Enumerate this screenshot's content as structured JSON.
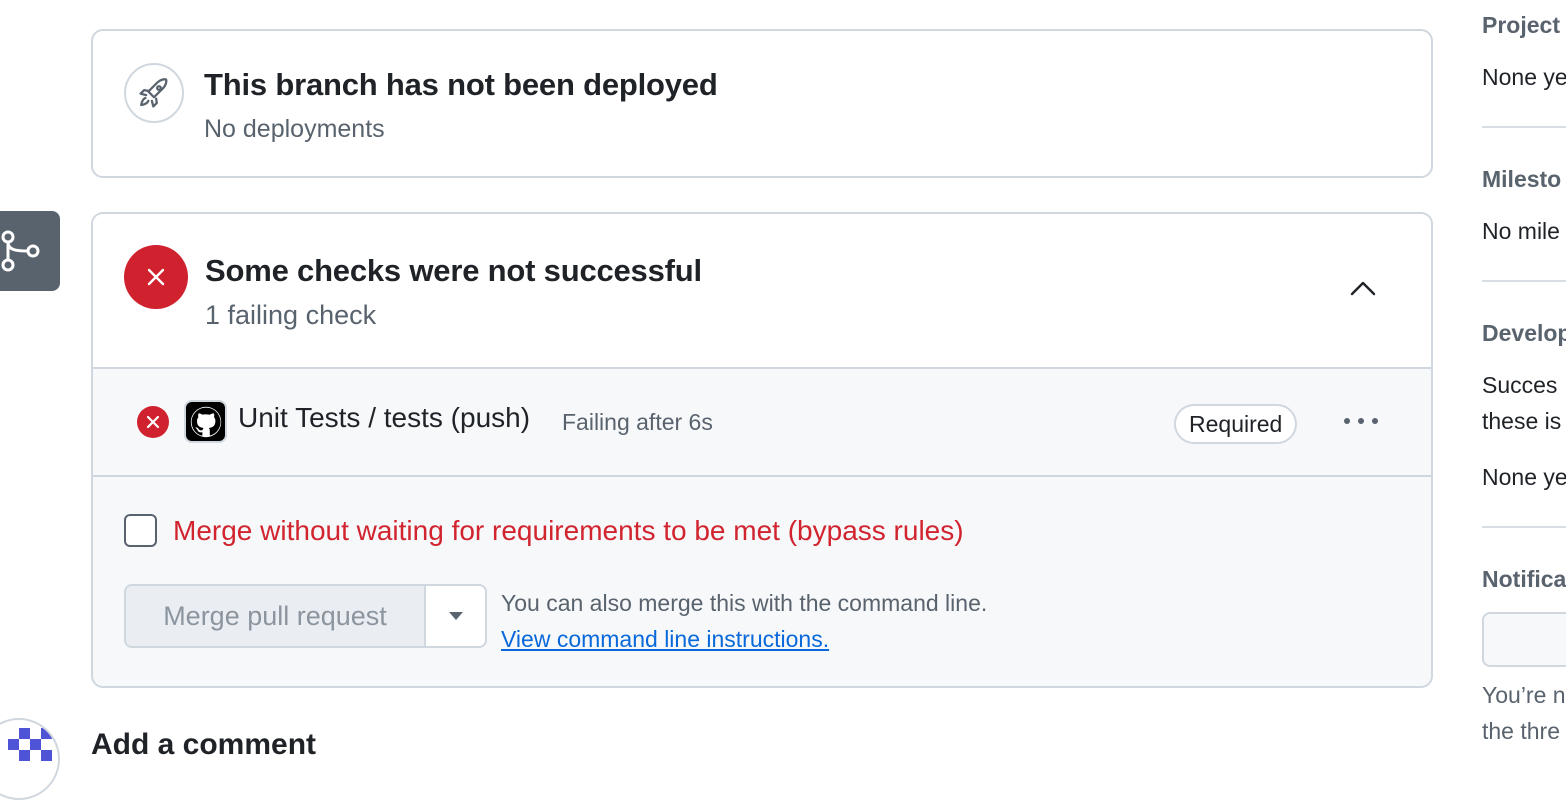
{
  "deployment": {
    "title": "This branch has not been deployed",
    "subtitle": "No deployments",
    "icon": "rocket-icon"
  },
  "checks": {
    "title": "Some checks were not successful",
    "subtitle": "1 failing check",
    "status_color": "#cf222e",
    "items": [
      {
        "name": "Unit Tests / tests (push)",
        "status": "Failing after 6s",
        "badge": "Required",
        "app_icon": "github-icon"
      }
    ]
  },
  "merge": {
    "bypass_label": "Merge without waiting for requirements to be met (bypass rules)",
    "bypass_checked": false,
    "button_label": "Merge pull request",
    "cmd_text": "You can also merge this with the command line.",
    "cmd_link": "View command line instructions."
  },
  "comment": {
    "title": "Add a comment"
  },
  "sidebar": {
    "projects_heading": "Project",
    "projects_value": "None ye",
    "milestone_heading": "Milesto",
    "milestone_value": "No mile",
    "development_heading": "Develop",
    "development_line1": "Succes",
    "development_line2": "these is",
    "development_value": "None ye",
    "notifications_heading": "Notifica",
    "notifications_line1": "You’re n",
    "notifications_line2": "the thre"
  },
  "colors": {
    "danger": "#cf222e",
    "danger_text": "#d1242f",
    "link": "#0969da",
    "border": "#d0d7de",
    "muted": "#59636e"
  }
}
